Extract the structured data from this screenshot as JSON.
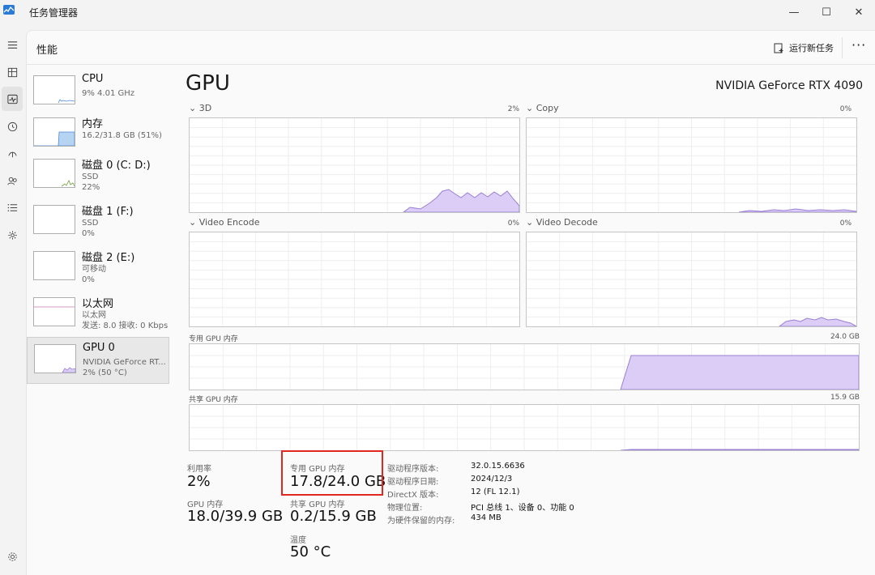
{
  "app": {
    "title": "任务管理器"
  },
  "window_controls": {
    "minimize": "—",
    "maximize": "☐",
    "close": "✕"
  },
  "rail": [
    "menu-icon",
    "processes-icon",
    "performance-icon",
    "history-icon",
    "startup-icon",
    "users-icon",
    "details-icon",
    "services-icon",
    "settings-icon"
  ],
  "header": {
    "title": "性能",
    "run_task": "运行新任务",
    "more": "···"
  },
  "sidebar": {
    "items": [
      {
        "name": "CPU",
        "sub": [
          "9% 4.01 GHz"
        ]
      },
      {
        "name": "内存",
        "sub": [
          "16.2/31.8 GB (51%)"
        ]
      },
      {
        "name": "磁盘 0 (C: D:)",
        "sub": [
          "SSD",
          "22%"
        ]
      },
      {
        "name": "磁盘 1 (F:)",
        "sub": [
          "SSD",
          "0%"
        ]
      },
      {
        "name": "磁盘 2 (E:)",
        "sub": [
          "可移动",
          "0%"
        ]
      },
      {
        "name": "以太网",
        "sub": [
          "以太网",
          "发送: 8.0 接收: 0 Kbps"
        ]
      },
      {
        "name": "GPU 0",
        "sub": [
          "NVIDIA GeForce RT...",
          "2% (50 °C)"
        ]
      }
    ]
  },
  "gpu": {
    "title": "GPU",
    "model": "NVIDIA GeForce RTX 4090",
    "engines": [
      {
        "label": "3D",
        "value": "2%"
      },
      {
        "label": "Copy",
        "value": "0%"
      },
      {
        "label": "Video Encode",
        "value": "0%"
      },
      {
        "label": "Video Decode",
        "value": "0%"
      }
    ],
    "dedicated": {
      "label": "专用 GPU 内存",
      "max": "24.0 GB"
    },
    "shared": {
      "label": "共享 GPU 内存",
      "max": "15.9 GB"
    }
  },
  "stats": {
    "utilization": {
      "label": "利用率",
      "value": "2%"
    },
    "dedicated": {
      "label": "专用 GPU 内存",
      "value": "17.8/24.0 GB"
    },
    "gpu_memory": {
      "label": "GPU 内存",
      "value": "18.0/39.9 GB"
    },
    "shared": {
      "label": "共享 GPU 内存",
      "value": "0.2/15.9 GB"
    },
    "temperature": {
      "label": "温度",
      "value": "50 °C"
    }
  },
  "details": [
    {
      "label": "驱动程序版本:",
      "value": "32.0.15.6636"
    },
    {
      "label": "驱动程序日期:",
      "value": "2024/12/3"
    },
    {
      "label": "DirectX 版本:",
      "value": "12 (FL 12.1)"
    },
    {
      "label": "物理位置:",
      "value": "PCI 总线 1、设备 0、功能 0"
    },
    {
      "label": "为硬件保留的内存:",
      "value": "434 MB"
    }
  ],
  "colors": {
    "gpu_fill": "#dccdf6",
    "gpu_line": "#9a7fd6",
    "mem_fill": "#b7d3f2",
    "mem_line": "#4a8ad8",
    "disk_line": "#6c9e3a",
    "highlight": "#e0281e"
  }
}
